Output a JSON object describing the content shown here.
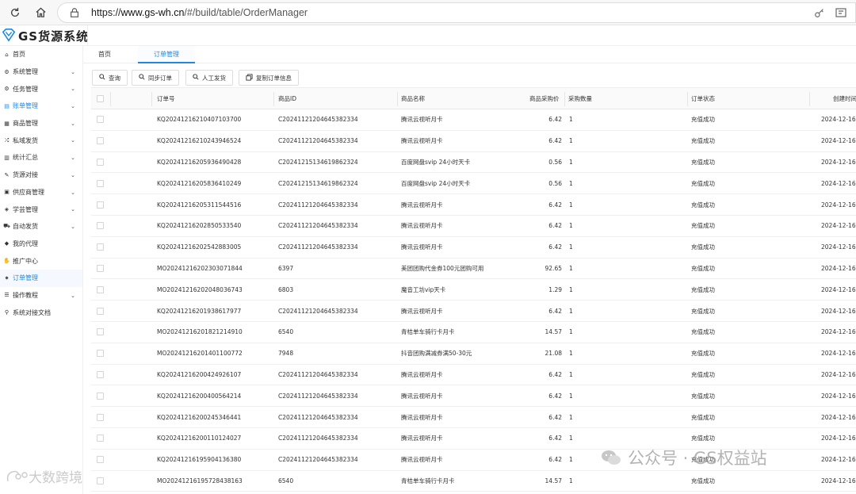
{
  "browser": {
    "url_prefix": "https://",
    "url_host": "www.gs-wh.cn",
    "url_path": "/#/build/table/OrderManager"
  },
  "app": {
    "logo_text": "GS货源系统"
  },
  "sidebar": {
    "items": [
      {
        "label": "首页",
        "icon": "home-icon",
        "chevron": false
      },
      {
        "label": "系统管理",
        "icon": "gear-icon",
        "chevron": true
      },
      {
        "label": "任务管理",
        "icon": "tasks-icon",
        "chevron": true
      },
      {
        "label": "账单管理",
        "icon": "bill-icon",
        "chevron": true,
        "active": true
      },
      {
        "label": "商品管理",
        "icon": "goods-icon",
        "chevron": true
      },
      {
        "label": "私域发货",
        "icon": "shuffle-icon",
        "chevron": true
      },
      {
        "label": "统计汇总",
        "icon": "stats-icon",
        "chevron": true
      },
      {
        "label": "货源对接",
        "icon": "plug-icon",
        "chevron": true
      },
      {
        "label": "供应商管理",
        "icon": "supplier-icon",
        "chevron": true
      },
      {
        "label": "学芸管理",
        "icon": "study-icon",
        "chevron": true
      },
      {
        "label": "自动发货",
        "icon": "truck-icon",
        "chevron": true
      },
      {
        "label": "我的代理",
        "icon": "agent-icon",
        "chevron": false
      },
      {
        "label": "推广中心",
        "icon": "promote-icon",
        "chevron": false
      },
      {
        "label": "订单管理",
        "icon": "order-icon",
        "chevron": false,
        "current": true
      },
      {
        "label": "操作教程",
        "icon": "list-icon",
        "chevron": true
      },
      {
        "label": "系统对接文档",
        "icon": "link-icon",
        "chevron": false
      }
    ]
  },
  "tabs": [
    {
      "label": "首页"
    },
    {
      "label": "订单管理",
      "active": true
    }
  ],
  "toolbar": {
    "query_label": "查询",
    "sync_label": "同步订单",
    "manual_label": "人工发货",
    "copy_label": "复制订单信息"
  },
  "table": {
    "headers": {
      "order_no": "订单号",
      "product_id": "商品ID",
      "product_name": "商品名称",
      "price": "商品采购价",
      "qty": "采购数量",
      "status": "订单状态",
      "created": "创建时间"
    },
    "rows": [
      {
        "order_no": "KQ20241216210407103700",
        "product_id": "C20241121204645382334",
        "product_name": "腾讯云视听月卡",
        "price": "6.42",
        "qty": "1",
        "status": "充值成功",
        "created": "2024-12-16"
      },
      {
        "order_no": "KQ20241216210243946524",
        "product_id": "C20241121204645382334",
        "product_name": "腾讯云视听月卡",
        "price": "6.42",
        "qty": "1",
        "status": "充值成功",
        "created": "2024-12-16"
      },
      {
        "order_no": "KQ20241216205936490428",
        "product_id": "C20241215134619862324",
        "product_name": "百度网盘svip 24小时天卡",
        "price": "0.56",
        "qty": "1",
        "status": "充值成功",
        "created": "2024-12-16"
      },
      {
        "order_no": "KQ20241216205836410249",
        "product_id": "C20241215134619862324",
        "product_name": "百度网盘svip 24小时天卡",
        "price": "0.56",
        "qty": "1",
        "status": "充值成功",
        "created": "2024-12-16"
      },
      {
        "order_no": "KQ20241216205311544516",
        "product_id": "C20241121204645382334",
        "product_name": "腾讯云视听月卡",
        "price": "6.42",
        "qty": "1",
        "status": "充值成功",
        "created": "2024-12-16"
      },
      {
        "order_no": "KQ20241216202850533540",
        "product_id": "C20241121204645382334",
        "product_name": "腾讯云视听月卡",
        "price": "6.42",
        "qty": "1",
        "status": "充值成功",
        "created": "2024-12-16"
      },
      {
        "order_no": "KQ20241216202542883005",
        "product_id": "C20241121204645382334",
        "product_name": "腾讯云视听月卡",
        "price": "6.42",
        "qty": "1",
        "status": "充值成功",
        "created": "2024-12-16"
      },
      {
        "order_no": "MO20241216202303071844",
        "product_id": "6397",
        "product_name": "美团团购代金券100元团购可用",
        "price": "92.65",
        "qty": "1",
        "status": "充值成功",
        "created": "2024-12-16"
      },
      {
        "order_no": "MO20241216202048036743",
        "product_id": "6803",
        "product_name": "魔音工坊vip天卡",
        "price": "1.29",
        "qty": "1",
        "status": "充值成功",
        "created": "2024-12-16"
      },
      {
        "order_no": "KQ20241216201938617977",
        "product_id": "C20241121204645382334",
        "product_name": "腾讯云视听月卡",
        "price": "6.42",
        "qty": "1",
        "status": "充值成功",
        "created": "2024-12-16"
      },
      {
        "order_no": "MO20241216201821214910",
        "product_id": "6540",
        "product_name": "青桔单车骑行卡月卡",
        "price": "14.57",
        "qty": "1",
        "status": "充值成功",
        "created": "2024-12-16"
      },
      {
        "order_no": "MO20241216201401100772",
        "product_id": "7948",
        "product_name": "抖音团购满减券满50-30元",
        "price": "21.08",
        "qty": "1",
        "status": "充值成功",
        "created": "2024-12-16"
      },
      {
        "order_no": "KQ20241216200424926107",
        "product_id": "C20241121204645382334",
        "product_name": "腾讯云视听月卡",
        "price": "6.42",
        "qty": "1",
        "status": "充值成功",
        "created": "2024-12-16"
      },
      {
        "order_no": "KQ20241216200400564214",
        "product_id": "C20241121204645382334",
        "product_name": "腾讯云视听月卡",
        "price": "6.42",
        "qty": "1",
        "status": "充值成功",
        "created": "2024-12-16"
      },
      {
        "order_no": "KQ20241216200245346441",
        "product_id": "C20241121204645382334",
        "product_name": "腾讯云视听月卡",
        "price": "6.42",
        "qty": "1",
        "status": "充值成功",
        "created": "2024-12-16"
      },
      {
        "order_no": "KQ20241216200110124027",
        "product_id": "C20241121204645382334",
        "product_name": "腾讯云视听月卡",
        "price": "6.42",
        "qty": "1",
        "status": "充值成功",
        "created": "2024-12-16"
      },
      {
        "order_no": "KQ20241216195904136380",
        "product_id": "C20241121204645382334",
        "product_name": "腾讯云视听月卡",
        "price": "6.42",
        "qty": "1",
        "status": "充值成功",
        "created": "2024-12-16"
      },
      {
        "order_no": "MO20241216195728438163",
        "product_id": "6540",
        "product_name": "青桔单车骑行卡月卡",
        "price": "14.57",
        "qty": "1",
        "status": "充值成功",
        "created": "2024-12-16"
      }
    ]
  },
  "watermarks": {
    "left": "大数跨境",
    "right": "公众号 · GS权益站"
  },
  "colors": {
    "accent": "#1e88e5"
  }
}
